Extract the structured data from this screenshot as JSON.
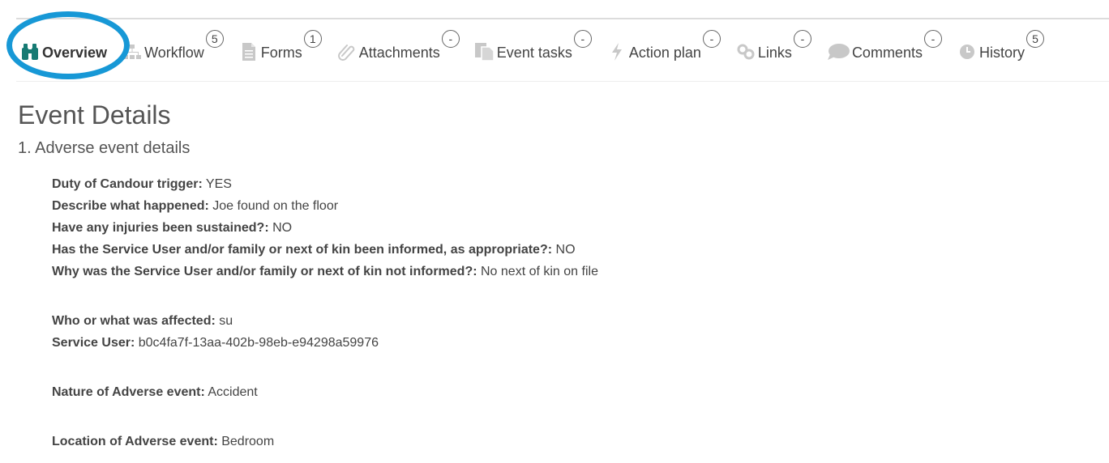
{
  "tabs": [
    {
      "label": "Overview",
      "icon": "binoculars-icon",
      "badge": null,
      "active": true
    },
    {
      "label": "Workflow",
      "icon": "sitemap-icon",
      "badge": "5"
    },
    {
      "label": "Forms",
      "icon": "document-icon",
      "badge": "1"
    },
    {
      "label": "Attachments",
      "icon": "paperclip-icon",
      "badge": "-"
    },
    {
      "label": "Event tasks",
      "icon": "copy-icon",
      "badge": "-"
    },
    {
      "label": "Action plan",
      "icon": "lightning-icon",
      "badge": "-"
    },
    {
      "label": "Links",
      "icon": "link-icon",
      "badge": "-"
    },
    {
      "label": "Comments",
      "icon": "speech-bubble-icon",
      "badge": "-"
    },
    {
      "label": "History",
      "icon": "clock-icon",
      "badge": "5"
    }
  ],
  "page": {
    "title": "Event Details",
    "section": "1. Adverse event details"
  },
  "fields": {
    "duty_candour": {
      "key": "Duty of Candour trigger:",
      "value": " YES"
    },
    "describe": {
      "key": "Describe what happened:",
      "value": " Joe found on the floor"
    },
    "injuries": {
      "key": "Have any injuries been sustained?:",
      "value": " NO"
    },
    "informed": {
      "key": "Has the Service User and/or family or next of kin been informed, as appropriate?:",
      "value": " NO"
    },
    "why_not": {
      "key": "Why was the Service User and/or family or next of kin not informed?:",
      "value": " No next of kin on file"
    },
    "affected": {
      "key": "Who or what was affected:",
      "value": " su"
    },
    "service_user": {
      "key": "Service User:",
      "value": " b0c4fa7f-13aa-402b-98eb-e94298a59976"
    },
    "nature": {
      "key": "Nature of Adverse event:",
      "value": " Accident"
    },
    "location": {
      "key": "Location of Adverse event:",
      "value": " Bedroom"
    }
  },
  "colors": {
    "accent_teal": "#167a73",
    "highlight_blue": "#1798d6",
    "icon_grey": "#c8c8c8"
  }
}
